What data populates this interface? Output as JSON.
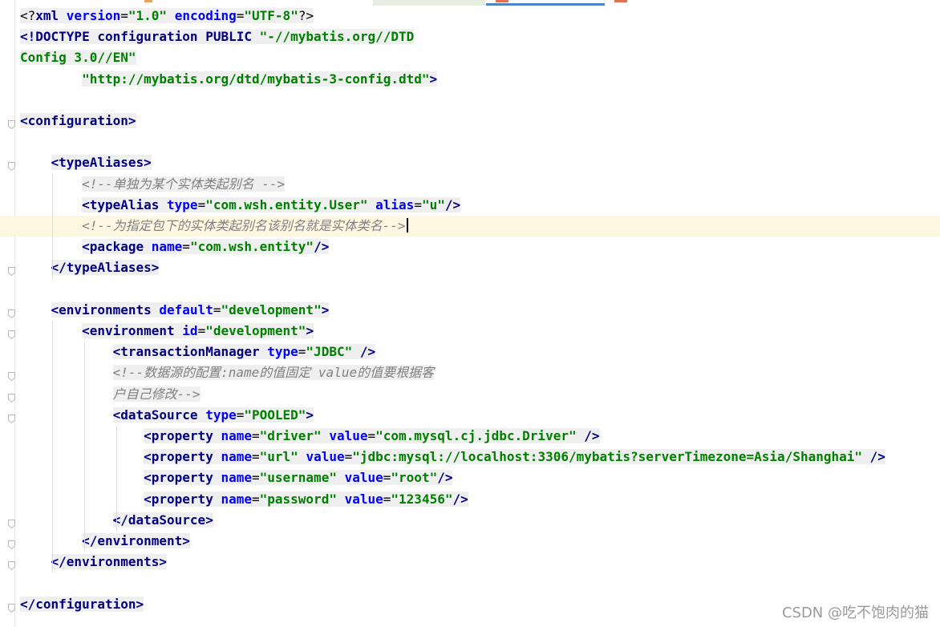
{
  "editor": {
    "lines": [
      {
        "id": "l1",
        "segments": [
          {
            "c": "plain",
            "t": "<?"
          },
          {
            "c": "tag",
            "t": "xml "
          },
          {
            "c": "attr",
            "t": "version"
          },
          {
            "c": "plain",
            "t": "="
          },
          {
            "c": "val",
            "t": "\"1.0\""
          },
          {
            "c": "plain",
            "t": " "
          },
          {
            "c": "attr",
            "t": "encoding"
          },
          {
            "c": "plain",
            "t": "="
          },
          {
            "c": "val",
            "t": "\"UTF-8\""
          },
          {
            "c": "plain",
            "t": "?>"
          }
        ]
      },
      {
        "id": "l2",
        "segments": [
          {
            "c": "tag",
            "t": "<!DOCTYPE "
          },
          {
            "c": "tag",
            "t": "configuration "
          },
          {
            "c": "tag",
            "t": "PUBLIC "
          },
          {
            "c": "val",
            "t": "\"-//mybatis.org//DTD"
          }
        ]
      },
      {
        "id": "l3",
        "segments": [
          {
            "c": "val",
            "t": "Config 3.0//EN\""
          }
        ]
      },
      {
        "id": "l4",
        "segments": [
          {
            "c": "plain",
            "t": "        "
          },
          {
            "c": "val",
            "t": "\"http://mybatis.org/dtd/mybatis-3-config.dtd\""
          },
          {
            "c": "tag",
            "t": ">"
          }
        ]
      },
      {
        "id": "l5",
        "segments": []
      },
      {
        "id": "l6",
        "segments": [
          {
            "c": "tag",
            "t": "<configuration>"
          }
        ]
      },
      {
        "id": "l7",
        "segments": []
      },
      {
        "id": "l8",
        "segments": [
          {
            "c": "plain",
            "t": "    "
          },
          {
            "c": "tag",
            "t": "<typeAliases>"
          }
        ]
      },
      {
        "id": "l9",
        "segments": [
          {
            "c": "plain",
            "t": "        "
          },
          {
            "c": "cm",
            "t": "<!--单独为某个实体类起别名 -->"
          }
        ]
      },
      {
        "id": "l10",
        "segments": [
          {
            "c": "plain",
            "t": "        "
          },
          {
            "c": "tag",
            "t": "<typeAlias "
          },
          {
            "c": "attr",
            "t": "type"
          },
          {
            "c": "plain",
            "t": "="
          },
          {
            "c": "val",
            "t": "\"com.wsh.entity.User\""
          },
          {
            "c": "plain",
            "t": " "
          },
          {
            "c": "attr",
            "t": "alias"
          },
          {
            "c": "plain",
            "t": "="
          },
          {
            "c": "val",
            "t": "\"u\""
          },
          {
            "c": "tag",
            "t": "/>"
          }
        ]
      },
      {
        "id": "l11",
        "current": true,
        "segments": [
          {
            "c": "plain",
            "t": "        "
          },
          {
            "c": "cm",
            "t": "<!--为指定包下的实体类起别名该别名就是实体类名-->"
          },
          {
            "c": "caret",
            "t": ""
          }
        ]
      },
      {
        "id": "l12",
        "segments": [
          {
            "c": "plain",
            "t": "        "
          },
          {
            "c": "tag",
            "t": "<package "
          },
          {
            "c": "attr",
            "t": "name"
          },
          {
            "c": "plain",
            "t": "="
          },
          {
            "c": "val",
            "t": "\"com.wsh.entity\""
          },
          {
            "c": "tag",
            "t": "/>"
          }
        ]
      },
      {
        "id": "l13",
        "segments": [
          {
            "c": "plain",
            "t": "    "
          },
          {
            "c": "tag",
            "t": "</typeAliases>"
          }
        ]
      },
      {
        "id": "l14",
        "segments": []
      },
      {
        "id": "l15",
        "segments": [
          {
            "c": "plain",
            "t": "    "
          },
          {
            "c": "tag",
            "t": "<environments "
          },
          {
            "c": "attr",
            "t": "default"
          },
          {
            "c": "plain",
            "t": "="
          },
          {
            "c": "val",
            "t": "\"development\""
          },
          {
            "c": "tag",
            "t": ">"
          }
        ]
      },
      {
        "id": "l16",
        "segments": [
          {
            "c": "plain",
            "t": "        "
          },
          {
            "c": "tag",
            "t": "<environment "
          },
          {
            "c": "attr",
            "t": "id"
          },
          {
            "c": "plain",
            "t": "="
          },
          {
            "c": "val",
            "t": "\"development\""
          },
          {
            "c": "tag",
            "t": ">"
          }
        ]
      },
      {
        "id": "l17",
        "segments": [
          {
            "c": "plain",
            "t": "            "
          },
          {
            "c": "tag",
            "t": "<transactionManager "
          },
          {
            "c": "attr",
            "t": "type"
          },
          {
            "c": "plain",
            "t": "="
          },
          {
            "c": "val",
            "t": "\"JDBC\""
          },
          {
            "c": "plain",
            "t": " "
          },
          {
            "c": "tag",
            "t": "/>"
          }
        ]
      },
      {
        "id": "l18",
        "segments": [
          {
            "c": "plain",
            "t": "            "
          },
          {
            "c": "cm",
            "t": "<!--数据源的配置:name的值固定 value的值要根据客"
          }
        ]
      },
      {
        "id": "l19",
        "segments": [
          {
            "c": "plain",
            "t": "            "
          },
          {
            "c": "cm",
            "t": "户自己修改-->"
          }
        ]
      },
      {
        "id": "l20",
        "segments": [
          {
            "c": "plain",
            "t": "            "
          },
          {
            "c": "tag",
            "t": "<dataSource "
          },
          {
            "c": "attr",
            "t": "type"
          },
          {
            "c": "plain",
            "t": "="
          },
          {
            "c": "val",
            "t": "\"POOLED\""
          },
          {
            "c": "tag",
            "t": ">"
          }
        ]
      },
      {
        "id": "l21",
        "segments": [
          {
            "c": "plain",
            "t": "                "
          },
          {
            "c": "tag",
            "t": "<property "
          },
          {
            "c": "attr",
            "t": "name"
          },
          {
            "c": "plain",
            "t": "="
          },
          {
            "c": "val",
            "t": "\"driver\""
          },
          {
            "c": "plain",
            "t": " "
          },
          {
            "c": "attr",
            "t": "value"
          },
          {
            "c": "plain",
            "t": "="
          },
          {
            "c": "val",
            "t": "\"com.mysql.cj.jdbc.Driver\""
          },
          {
            "c": "plain",
            "t": " "
          },
          {
            "c": "tag",
            "t": "/>"
          }
        ]
      },
      {
        "id": "l22",
        "segments": [
          {
            "c": "plain",
            "t": "                "
          },
          {
            "c": "tag",
            "t": "<property "
          },
          {
            "c": "attr",
            "t": "name"
          },
          {
            "c": "plain",
            "t": "="
          },
          {
            "c": "val",
            "t": "\"url\""
          },
          {
            "c": "plain",
            "t": " "
          },
          {
            "c": "attr",
            "t": "value"
          },
          {
            "c": "plain",
            "t": "="
          },
          {
            "c": "val",
            "t": "\"jdbc:mysql://localhost:3306/mybatis?serverTimezone=Asia/Shanghai\""
          },
          {
            "c": "plain",
            "t": " "
          },
          {
            "c": "tag",
            "t": "/>"
          }
        ]
      },
      {
        "id": "l23",
        "segments": [
          {
            "c": "plain",
            "t": "                "
          },
          {
            "c": "tag",
            "t": "<property "
          },
          {
            "c": "attr",
            "t": "name"
          },
          {
            "c": "plain",
            "t": "="
          },
          {
            "c": "val",
            "t": "\"username\""
          },
          {
            "c": "plain",
            "t": " "
          },
          {
            "c": "attr",
            "t": "value"
          },
          {
            "c": "plain",
            "t": "="
          },
          {
            "c": "val",
            "t": "\"root\""
          },
          {
            "c": "tag",
            "t": "/>"
          }
        ]
      },
      {
        "id": "l24",
        "segments": [
          {
            "c": "plain",
            "t": "                "
          },
          {
            "c": "tag",
            "t": "<property "
          },
          {
            "c": "attr",
            "t": "name"
          },
          {
            "c": "plain",
            "t": "="
          },
          {
            "c": "val",
            "t": "\"password\""
          },
          {
            "c": "plain",
            "t": " "
          },
          {
            "c": "attr",
            "t": "value"
          },
          {
            "c": "plain",
            "t": "="
          },
          {
            "c": "val",
            "t": "\"123456\""
          },
          {
            "c": "tag",
            "t": "/>"
          }
        ]
      },
      {
        "id": "l25",
        "segments": [
          {
            "c": "plain",
            "t": "            "
          },
          {
            "c": "tag",
            "t": "</dataSource>"
          }
        ]
      },
      {
        "id": "l26",
        "segments": [
          {
            "c": "plain",
            "t": "        "
          },
          {
            "c": "tag",
            "t": "</environment>"
          }
        ]
      },
      {
        "id": "l27",
        "segments": [
          {
            "c": "plain",
            "t": "    "
          },
          {
            "c": "tag",
            "t": "</environments>"
          }
        ]
      },
      {
        "id": "l28",
        "segments": []
      },
      {
        "id": "l29",
        "segments": [
          {
            "c": "tag",
            "t": "</configuration>"
          }
        ]
      }
    ]
  },
  "colors": {
    "tag": "#000080",
    "attribute": "#0000ff",
    "value": "#008000",
    "comment": "#808080",
    "current_line": "#fdf7e2"
  },
  "watermark": "CSDN @吃不饱肉的猫"
}
